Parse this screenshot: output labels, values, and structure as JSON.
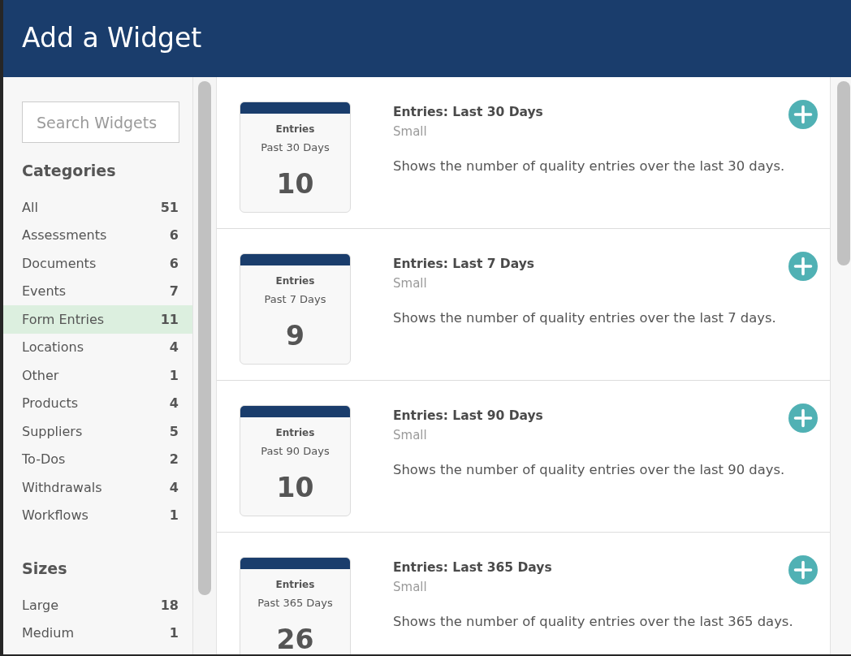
{
  "dialog": {
    "title": "Add a Widget"
  },
  "sidebar": {
    "search": {
      "placeholder": "Search Widgets"
    },
    "sections": [
      {
        "heading": "Categories",
        "items": [
          {
            "label": "All",
            "count": "51",
            "selected": false
          },
          {
            "label": "Assessments",
            "count": "6",
            "selected": false
          },
          {
            "label": "Documents",
            "count": "6",
            "selected": false
          },
          {
            "label": "Events",
            "count": "7",
            "selected": false
          },
          {
            "label": "Form Entries",
            "count": "11",
            "selected": true
          },
          {
            "label": "Locations",
            "count": "4",
            "selected": false
          },
          {
            "label": "Other",
            "count": "1",
            "selected": false
          },
          {
            "label": "Products",
            "count": "4",
            "selected": false
          },
          {
            "label": "Suppliers",
            "count": "5",
            "selected": false
          },
          {
            "label": "To-Dos",
            "count": "2",
            "selected": false
          },
          {
            "label": "Withdrawals",
            "count": "4",
            "selected": false
          },
          {
            "label": "Workflows",
            "count": "1",
            "selected": false
          }
        ]
      },
      {
        "heading": "Sizes",
        "items": [
          {
            "label": "Large",
            "count": "18",
            "selected": false
          },
          {
            "label": "Medium",
            "count": "1",
            "selected": false
          }
        ]
      }
    ]
  },
  "widgets": [
    {
      "preview": {
        "heading": "Entries",
        "period": "Past 30 Days",
        "value": "10"
      },
      "title": "Entries: Last 30 Days",
      "size": "Small",
      "description": "Shows the number of quality entries over the last 30 days."
    },
    {
      "preview": {
        "heading": "Entries",
        "period": "Past 7 Days",
        "value": "9"
      },
      "title": "Entries: Last 7 Days",
      "size": "Small",
      "description": "Shows the number of quality entries over the last 7 days."
    },
    {
      "preview": {
        "heading": "Entries",
        "period": "Past 90 Days",
        "value": "10"
      },
      "title": "Entries: Last 90 Days",
      "size": "Small",
      "description": "Shows the number of quality entries over the last 90 days."
    },
    {
      "preview": {
        "heading": "Entries",
        "period": "Past 365 Days",
        "value": "26"
      },
      "title": "Entries: Last 365 Days",
      "size": "Small",
      "description": "Shows the number of quality entries over the last 365 days."
    }
  ]
}
